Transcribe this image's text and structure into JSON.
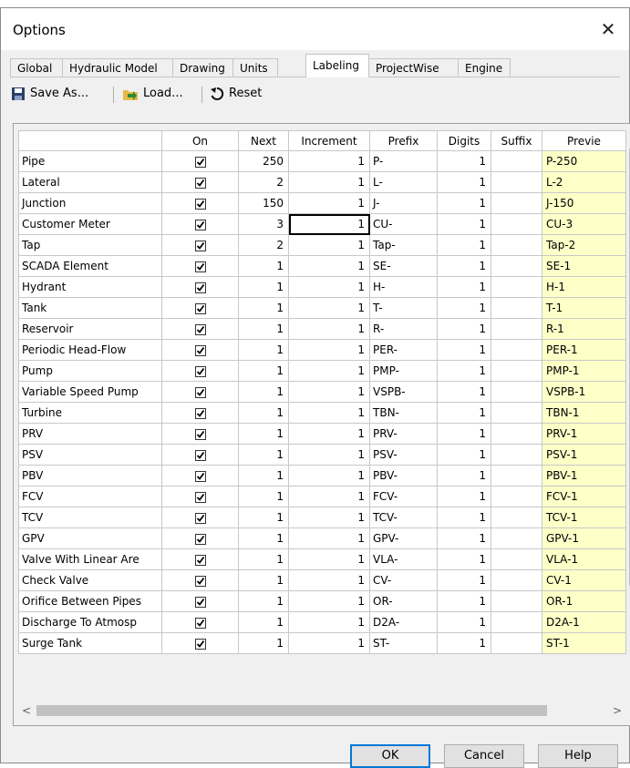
{
  "window": {
    "title": "Options",
    "close_glyph": "✕"
  },
  "tabs": [
    {
      "label": "Global",
      "active": false
    },
    {
      "label": "Hydraulic Model",
      "active": false
    },
    {
      "label": "Drawing",
      "active": false
    },
    {
      "label": "Units",
      "active": false
    },
    {
      "label": "Labeling",
      "active": true
    },
    {
      "label": "ProjectWise",
      "active": false
    },
    {
      "label": "Engine",
      "active": false
    }
  ],
  "toolbar": {
    "save_label": "Save As...",
    "load_label": "Load...",
    "reset_label": "Reset",
    "icons": [
      "save-icon",
      "load-icon",
      "reset-icon"
    ]
  },
  "grid": {
    "columns": [
      "",
      "On",
      "Next",
      "Increment",
      "Prefix",
      "Digits",
      "Suffix",
      "Previe"
    ],
    "rows": [
      {
        "name": "Pipe",
        "on": true,
        "next": "250",
        "increment": "1",
        "prefix": "P-",
        "digits": "1",
        "suffix": "",
        "preview": "P-250"
      },
      {
        "name": "Lateral",
        "on": true,
        "next": "2",
        "increment": "1",
        "prefix": "L-",
        "digits": "1",
        "suffix": "",
        "preview": "L-2"
      },
      {
        "name": "Junction",
        "on": true,
        "next": "150",
        "increment": "1",
        "prefix": "J-",
        "digits": "1",
        "suffix": "",
        "preview": "J-150"
      },
      {
        "name": "Customer Meter",
        "on": true,
        "next": "3",
        "increment": "1",
        "prefix": "CU-",
        "digits": "1",
        "suffix": "",
        "preview": "CU-3"
      },
      {
        "name": "Tap",
        "on": true,
        "next": "2",
        "increment": "1",
        "prefix": "Tap-",
        "digits": "1",
        "suffix": "",
        "preview": "Tap-2"
      },
      {
        "name": "SCADA Element",
        "on": true,
        "next": "1",
        "increment": "1",
        "prefix": "SE-",
        "digits": "1",
        "suffix": "",
        "preview": "SE-1"
      },
      {
        "name": "Hydrant",
        "on": true,
        "next": "1",
        "increment": "1",
        "prefix": "H-",
        "digits": "1",
        "suffix": "",
        "preview": "H-1"
      },
      {
        "name": "Tank",
        "on": true,
        "next": "1",
        "increment": "1",
        "prefix": "T-",
        "digits": "1",
        "suffix": "",
        "preview": "T-1"
      },
      {
        "name": "Reservoir",
        "on": true,
        "next": "1",
        "increment": "1",
        "prefix": "R-",
        "digits": "1",
        "suffix": "",
        "preview": "R-1"
      },
      {
        "name": "Periodic Head-Flow",
        "on": true,
        "next": "1",
        "increment": "1",
        "prefix": "PER-",
        "digits": "1",
        "suffix": "",
        "preview": "PER-1"
      },
      {
        "name": "Pump",
        "on": true,
        "next": "1",
        "increment": "1",
        "prefix": "PMP-",
        "digits": "1",
        "suffix": "",
        "preview": "PMP-1"
      },
      {
        "name": "Variable Speed Pump",
        "on": true,
        "next": "1",
        "increment": "1",
        "prefix": "VSPB-",
        "digits": "1",
        "suffix": "",
        "preview": "VSPB-1"
      },
      {
        "name": "Turbine",
        "on": true,
        "next": "1",
        "increment": "1",
        "prefix": "TBN-",
        "digits": "1",
        "suffix": "",
        "preview": "TBN-1"
      },
      {
        "name": "PRV",
        "on": true,
        "next": "1",
        "increment": "1",
        "prefix": "PRV-",
        "digits": "1",
        "suffix": "",
        "preview": "PRV-1"
      },
      {
        "name": "PSV",
        "on": true,
        "next": "1",
        "increment": "1",
        "prefix": "PSV-",
        "digits": "1",
        "suffix": "",
        "preview": "PSV-1"
      },
      {
        "name": "PBV",
        "on": true,
        "next": "1",
        "increment": "1",
        "prefix": "PBV-",
        "digits": "1",
        "suffix": "",
        "preview": "PBV-1"
      },
      {
        "name": "FCV",
        "on": true,
        "next": "1",
        "increment": "1",
        "prefix": "FCV-",
        "digits": "1",
        "suffix": "",
        "preview": "FCV-1"
      },
      {
        "name": "TCV",
        "on": true,
        "next": "1",
        "increment": "1",
        "prefix": "TCV-",
        "digits": "1",
        "suffix": "",
        "preview": "TCV-1"
      },
      {
        "name": "GPV",
        "on": true,
        "next": "1",
        "increment": "1",
        "prefix": "GPV-",
        "digits": "1",
        "suffix": "",
        "preview": "GPV-1"
      },
      {
        "name": "Valve With Linear Are",
        "on": true,
        "next": "1",
        "increment": "1",
        "prefix": "VLA-",
        "digits": "1",
        "suffix": "",
        "preview": "VLA-1"
      },
      {
        "name": "Check Valve",
        "on": true,
        "next": "1",
        "increment": "1",
        "prefix": "CV-",
        "digits": "1",
        "suffix": "",
        "preview": "CV-1"
      },
      {
        "name": "Orifice Between Pipes",
        "on": true,
        "next": "1",
        "increment": "1",
        "prefix": "OR-",
        "digits": "1",
        "suffix": "",
        "preview": "OR-1"
      },
      {
        "name": "Discharge To Atmosp",
        "on": true,
        "next": "1",
        "increment": "1",
        "prefix": "D2A-",
        "digits": "1",
        "suffix": "",
        "preview": "D2A-1"
      },
      {
        "name": "Surge Tank",
        "on": true,
        "next": "1",
        "increment": "1",
        "prefix": "ST-",
        "digits": "1",
        "suffix": "",
        "preview": "ST-1"
      }
    ],
    "focused_cell": {
      "row": 3,
      "column": "increment"
    }
  },
  "buttons": {
    "ok": "OK",
    "cancel": "Cancel",
    "help": "Help"
  },
  "colors": {
    "preview_bg": "#ffffc8",
    "default_button_border": "#0078d7",
    "load_icon": "#2e8b2e"
  }
}
